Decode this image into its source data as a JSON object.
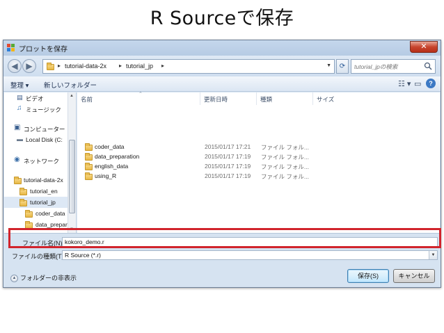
{
  "slide": {
    "title": "R Sourceで保存"
  },
  "dialog": {
    "title": "プロットを保存",
    "close_label": "✕",
    "address": {
      "crumbs": [
        "tutorial-data-2x",
        "tutorial_jp"
      ],
      "search_placeholder": "tutorial_jpの検索"
    },
    "toolbar": {
      "organize": "整理 ▾",
      "new_folder": "新しいフォルダー",
      "view_icon": "☷ ▾",
      "help_icon": "?"
    },
    "nav": {
      "items": [
        {
          "label": "ビデオ",
          "icon": "video-icon"
        },
        {
          "label": "ミュージック",
          "icon": "music-icon"
        },
        {
          "label": "コンピューター",
          "icon": "computer-icon"
        },
        {
          "label": "Local Disk (C:",
          "icon": "disk-icon"
        },
        {
          "label": "ネットワーク",
          "icon": "network-icon"
        },
        {
          "label": "tutorial-data-2x",
          "icon": "folder-icon"
        },
        {
          "label": "tutorial_en",
          "icon": "folder-icon"
        },
        {
          "label": "tutorial_jp",
          "icon": "folder-icon"
        },
        {
          "label": "coder_data",
          "icon": "folder-icon"
        },
        {
          "label": "data_prepar",
          "icon": "folder-icon"
        }
      ]
    },
    "columns": [
      "名前",
      "更新日時",
      "種類",
      "サイズ"
    ],
    "files": [
      {
        "name": "coder_data",
        "date": "2015/01/17 17:21",
        "type": "ファイル フォル..."
      },
      {
        "name": "data_preparation",
        "date": "2015/01/17 17:19",
        "type": "ファイル フォル..."
      },
      {
        "name": "english_data",
        "date": "2015/01/17 17:19",
        "type": "ファイル フォル..."
      },
      {
        "name": "using_R",
        "date": "2015/01/17 17:19",
        "type": "ファイル フォル..."
      }
    ],
    "filename": {
      "label": "ファイル名(N):",
      "value": "kokoro_demo.r"
    },
    "filetype": {
      "label": "ファイルの種類(T):",
      "value": "R Source (*.r)"
    },
    "hide_folders": "フォルダーの非表示",
    "save_button": "保存(S)",
    "cancel_button": "キャンセル",
    "highlight_color": "#d1242c"
  }
}
